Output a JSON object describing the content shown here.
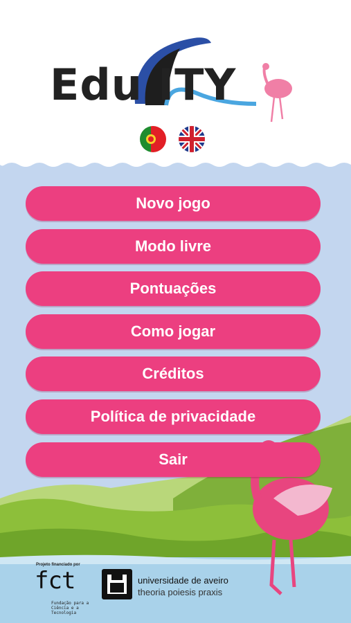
{
  "logo": {
    "brand_left": "Edu",
    "brand_right": "ITY"
  },
  "languages": [
    {
      "name": "pt-flag-icon",
      "code": "Português"
    },
    {
      "name": "uk-flag-icon",
      "code": "English"
    }
  ],
  "menu": {
    "items": [
      {
        "label": "Novo jogo"
      },
      {
        "label": "Modo livre"
      },
      {
        "label": "Pontuações"
      },
      {
        "label": "Como jogar"
      },
      {
        "label": "Créditos"
      },
      {
        "label": "Política de privacidade"
      },
      {
        "label": "Sair"
      }
    ]
  },
  "footer": {
    "funding_label": "Projeto financiado por",
    "fct_logo": "fct",
    "fct_desc": "Fundação para a Ciência e a Tecnologia",
    "university_name": "universidade de aveiro",
    "university_motto": "theoria poiesis praxis"
  },
  "colors": {
    "button": "#ec3f80",
    "sky": "#c3d6ef",
    "hills": "#8dbf3a",
    "water": "#a9d2ea",
    "flamingo": "#e8457f"
  }
}
